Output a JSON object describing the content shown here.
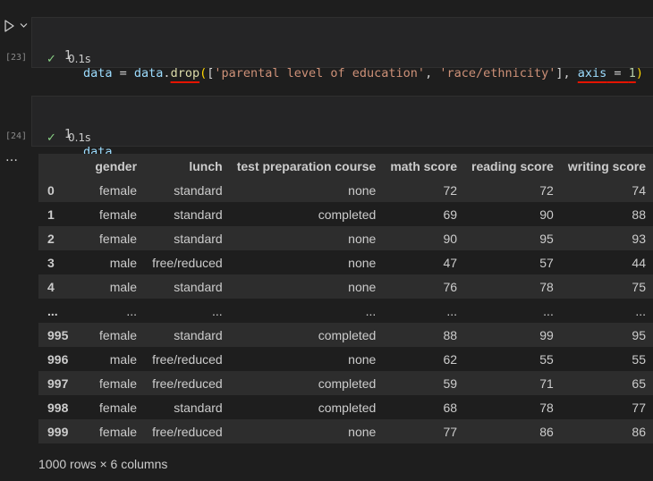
{
  "cells": [
    {
      "execution_count": "[23]",
      "line_number": "1",
      "status_icon": "check-icon",
      "duration": "0.1s",
      "code": {
        "t1": "data",
        "t2": " = ",
        "t3": "data",
        "t4": ".",
        "t5": "drop",
        "t6": "(",
        "t7": "[",
        "t8": "'parental level of education'",
        "t9": ", ",
        "t10": "'race/ethnicity'",
        "t11": "]",
        "t12": ", ",
        "t13": "axis",
        "t14": " = ",
        "t15": "1",
        "t16": ")"
      }
    },
    {
      "execution_count": "[24]",
      "line_number": "1",
      "status_icon": "check-icon",
      "duration": "0.1s",
      "code": {
        "t1": "data"
      }
    }
  ],
  "output_more": "…",
  "dataframe": {
    "columns": [
      "",
      "gender",
      "lunch",
      "test preparation course",
      "math score",
      "reading score",
      "writing score"
    ],
    "rows": [
      [
        "0",
        "female",
        "standard",
        "none",
        "72",
        "72",
        "74"
      ],
      [
        "1",
        "female",
        "standard",
        "completed",
        "69",
        "90",
        "88"
      ],
      [
        "2",
        "female",
        "standard",
        "none",
        "90",
        "95",
        "93"
      ],
      [
        "3",
        "male",
        "free/reduced",
        "none",
        "47",
        "57",
        "44"
      ],
      [
        "4",
        "male",
        "standard",
        "none",
        "76",
        "78",
        "75"
      ],
      [
        "...",
        "...",
        "...",
        "...",
        "...",
        "...",
        "..."
      ],
      [
        "995",
        "female",
        "standard",
        "completed",
        "88",
        "99",
        "95"
      ],
      [
        "996",
        "male",
        "free/reduced",
        "none",
        "62",
        "55",
        "55"
      ],
      [
        "997",
        "female",
        "free/reduced",
        "completed",
        "59",
        "71",
        "65"
      ],
      [
        "998",
        "female",
        "standard",
        "completed",
        "68",
        "78",
        "77"
      ],
      [
        "999",
        "female",
        "free/reduced",
        "none",
        "77",
        "86",
        "86"
      ]
    ],
    "footer": "1000 rows × 6 columns"
  },
  "colors": {
    "background": "#1e1e1e",
    "cell_background": "#252526",
    "success": "#89d185",
    "error_squiggle": "#e51400"
  }
}
